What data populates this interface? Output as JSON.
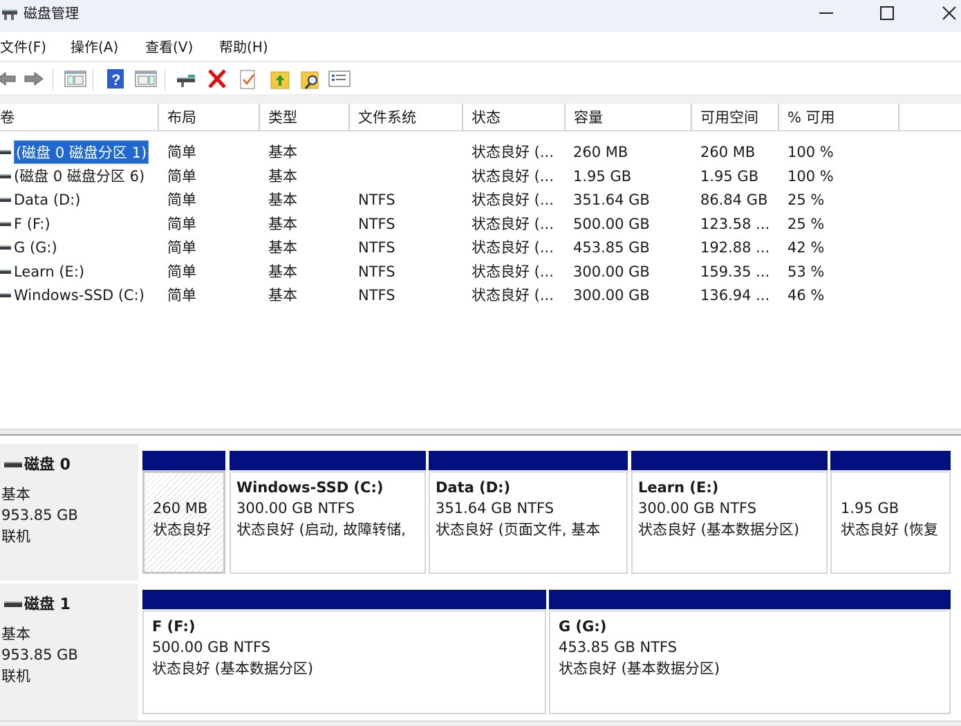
{
  "window": {
    "title": "磁盘管理"
  },
  "menu": [
    "文件(F)",
    "操作(A)",
    "查看(V)",
    "帮助(H)"
  ],
  "toolbar": {
    "icons": [
      "back-arrow-icon",
      "forward-arrow-icon",
      "console-tree-icon",
      "help-icon",
      "action-pane-icon",
      "connect-disk-icon",
      "delete-icon",
      "check-icon",
      "folder-up-icon",
      "search-folder-icon",
      "properties-list-icon"
    ]
  },
  "columns": [
    "卷",
    "布局",
    "类型",
    "文件系统",
    "状态",
    "容量",
    "可用空间",
    "% 可用"
  ],
  "rows": [
    {
      "volume": "(磁盘 0 磁盘分区 1)",
      "layout": "简单",
      "type": "基本",
      "fs": "",
      "status": "状态良好 (...",
      "capacity": "260 MB",
      "free": "260 MB",
      "pct": "100 %",
      "selected": true
    },
    {
      "volume": "(磁盘 0 磁盘分区 6)",
      "layout": "简单",
      "type": "基本",
      "fs": "",
      "status": "状态良好 (...",
      "capacity": "1.95 GB",
      "free": "1.95 GB",
      "pct": "100 %"
    },
    {
      "volume": "Data (D:)",
      "layout": "简单",
      "type": "基本",
      "fs": "NTFS",
      "status": "状态良好 (...",
      "capacity": "351.64 GB",
      "free": "86.84 GB",
      "pct": "25 %"
    },
    {
      "volume": "F (F:)",
      "layout": "简单",
      "type": "基本",
      "fs": "NTFS",
      "status": "状态良好 (...",
      "capacity": "500.00 GB",
      "free": "123.58 ...",
      "pct": "25 %"
    },
    {
      "volume": "G (G:)",
      "layout": "简单",
      "type": "基本",
      "fs": "NTFS",
      "status": "状态良好 (...",
      "capacity": "453.85 GB",
      "free": "192.88 ...",
      "pct": "42 %"
    },
    {
      "volume": "Learn (E:)",
      "layout": "简单",
      "type": "基本",
      "fs": "NTFS",
      "status": "状态良好 (...",
      "capacity": "300.00 GB",
      "free": "159.35 ...",
      "pct": "53 %"
    },
    {
      "volume": "Windows-SSD (C:)",
      "layout": "简单",
      "type": "基本",
      "fs": "NTFS",
      "status": "状态良好 (...",
      "capacity": "300.00 GB",
      "free": "136.94 ...",
      "pct": "46 %"
    }
  ],
  "disks": [
    {
      "name": "磁盘 0",
      "kind": "基本",
      "size": "953.85 GB",
      "state": "联机",
      "partitions": [
        {
          "title": "",
          "size": "260 MB",
          "status": "状态良好"
        },
        {
          "title": "Windows-SSD  (C:)",
          "size": "300.00 GB NTFS",
          "status": "状态良好 (启动, 故障转储,"
        },
        {
          "title": "Data  (D:)",
          "size": "351.64 GB NTFS",
          "status": "状态良好 (页面文件, 基本"
        },
        {
          "title": "Learn  (E:)",
          "size": "300.00 GB NTFS",
          "status": "状态良好 (基本数据分区)"
        },
        {
          "title": "",
          "size": "1.95 GB",
          "status": "状态良好 (恢复"
        }
      ]
    },
    {
      "name": "磁盘 1",
      "kind": "基本",
      "size": "953.85 GB",
      "state": "联机",
      "partitions": [
        {
          "title": "F  (F:)",
          "size": "500.00 GB NTFS",
          "status": "状态良好 (基本数据分区)"
        },
        {
          "title": "G  (G:)",
          "size": "453.85 GB NTFS",
          "status": "状态良好 (基本数据分区)"
        }
      ]
    }
  ],
  "colors": {
    "partition_bar": "#04107e",
    "selection": "#1e68d0",
    "titlebar": "#eef2f8"
  }
}
